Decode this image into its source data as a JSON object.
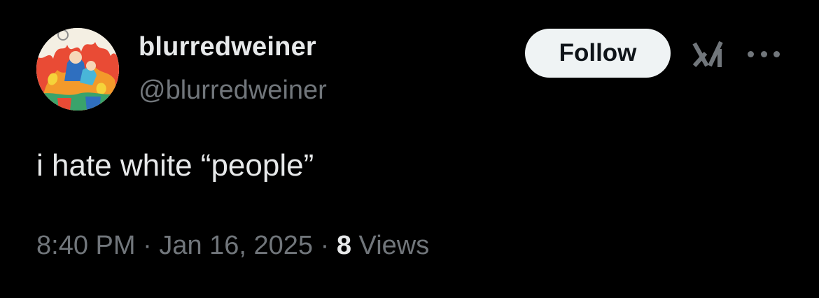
{
  "user": {
    "display_name": "blurredweiner",
    "handle": "@blurredweiner",
    "avatar": "cartoon-avatar"
  },
  "actions": {
    "follow_label": "Follow",
    "grok_icon": "grok-icon",
    "more_icon": "more-icon"
  },
  "tweet": {
    "text": "i hate white “people”",
    "time": "8:40 PM",
    "sep1": " · ",
    "date": "Jan 16, 2025",
    "sep2": " · ",
    "views_count": "8",
    "views_label": " Views"
  },
  "colors": {
    "background": "#000000",
    "primary_text": "#e7e9ea",
    "secondary_text": "#71767b",
    "follow_button_bg": "#eff3f4"
  }
}
